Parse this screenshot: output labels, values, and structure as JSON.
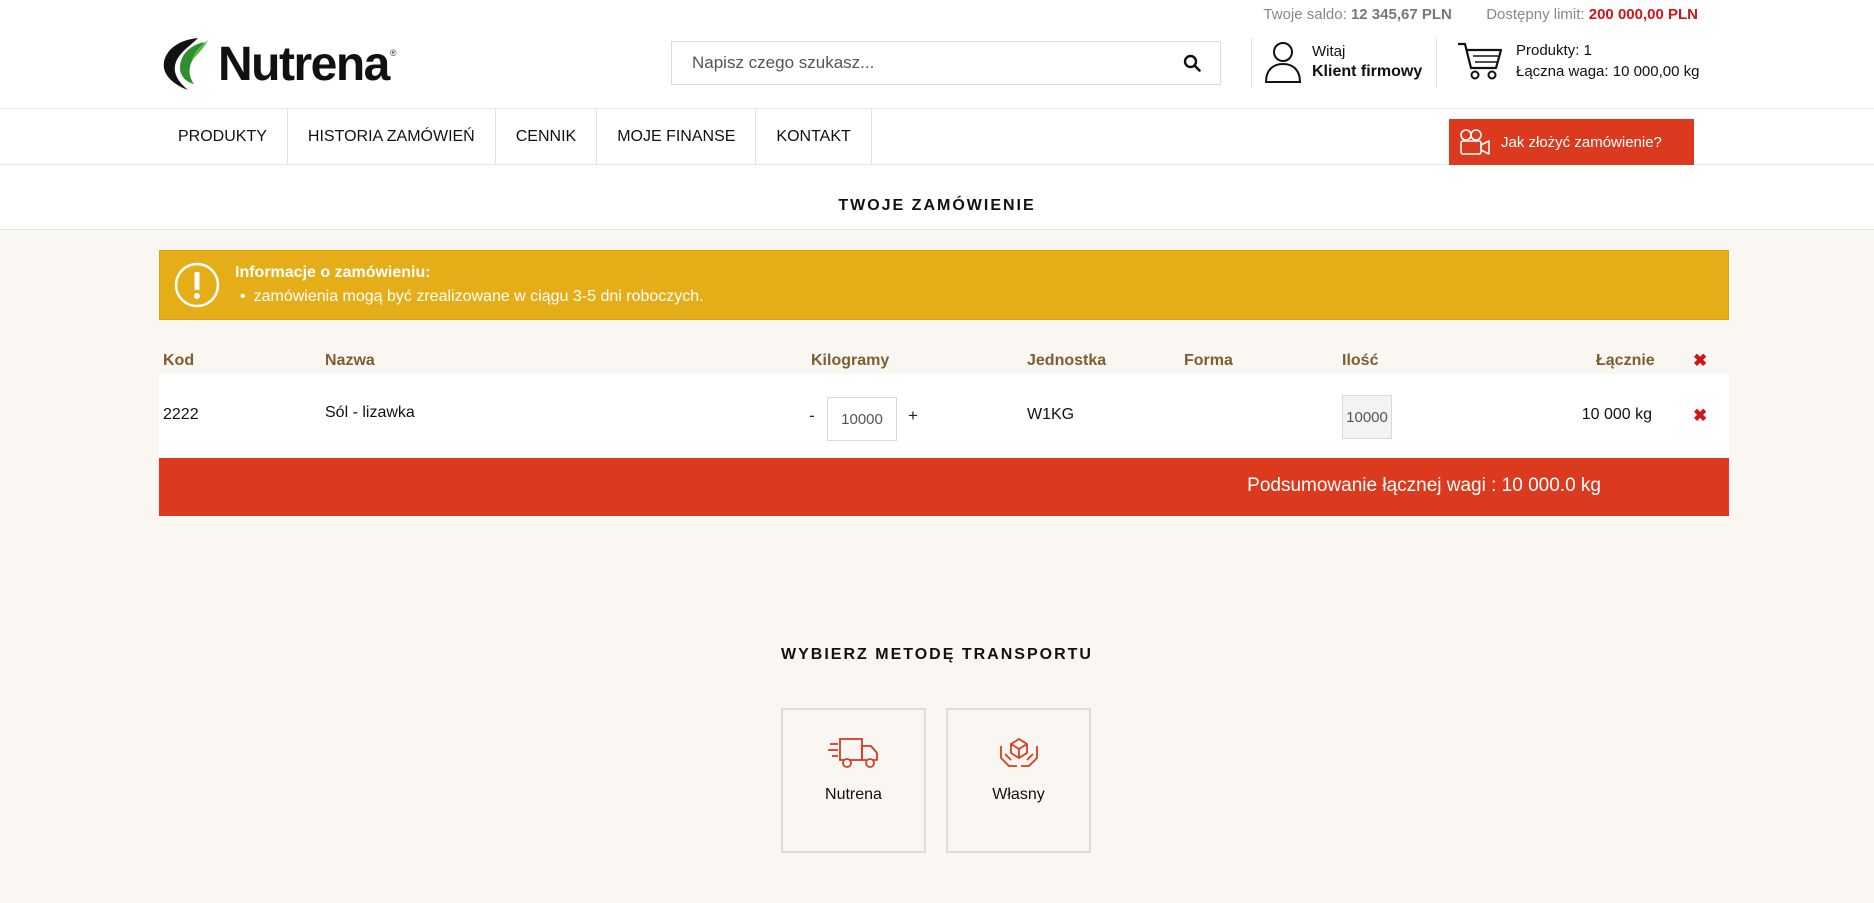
{
  "topbar": {
    "balance_label": "Twoje saldo:",
    "balance_value": "12 345,67 PLN",
    "limit_label": "Dostępny limit:",
    "limit_value": "200 000,00 PLN"
  },
  "brand": {
    "name": "Nutrena",
    "reg": "®"
  },
  "search": {
    "placeholder": "Napisz czego szukasz..."
  },
  "account": {
    "greeting": "Witaj",
    "name": "Klient firmowy"
  },
  "cart": {
    "products": "Produkty: 1",
    "weight": "Łączna waga: 10 000,00 kg"
  },
  "nav": {
    "items": [
      "PRODUKTY",
      "HISTORIA ZAMÓWIEŃ",
      "CENNIK",
      "MOJE FINANSE",
      "KONTAKT"
    ],
    "howto_label": "Jak złożyć zamówienie?"
  },
  "order": {
    "title": "TWOJE ZAMÓWIENIE",
    "alert_title": "Informacje o zamówieniu:",
    "alert_item": "zamówienia mogą być zrealizowane w ciągu 3-5 dni roboczych.",
    "columns": {
      "code": "Kod",
      "name": "Nazwa",
      "kg": "Kilogramy",
      "unit": "Jednostka",
      "form": "Forma",
      "qty": "Ilość",
      "total": "Łącznie"
    },
    "rows": [
      {
        "code": "2222",
        "name": "Sól - lizawka",
        "kg": "10000",
        "unit": "W1KG",
        "form": "",
        "qty": "10000",
        "total": "10 000 kg"
      }
    ],
    "stepper_minus": "-",
    "stepper_plus": "+",
    "remove_glyph": "✖",
    "summary": "Podsumowanie łącznej wagi : 10 000.0 kg"
  },
  "transport": {
    "title": "WYBIERZ METODĘ TRANSPORTU",
    "options": [
      {
        "label": "Nutrena",
        "icon": "truck-icon"
      },
      {
        "label": "Własny",
        "icon": "hands-box-icon"
      }
    ]
  },
  "colors": {
    "accent": "#dc3a1f",
    "alert": "#e5ae18",
    "header_text": "#7b5e32",
    "limit": "#d0141b"
  }
}
